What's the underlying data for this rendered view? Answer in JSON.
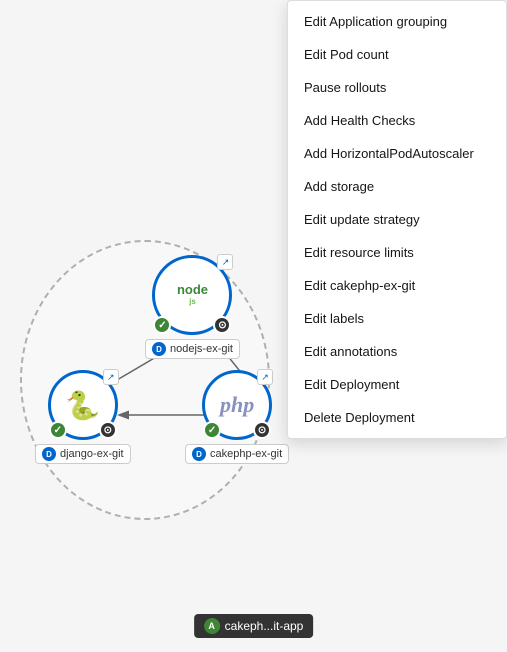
{
  "background": {
    "color": "#f5f5f5"
  },
  "menu": {
    "items": [
      {
        "id": "edit-app-grouping",
        "label": "Edit Application grouping"
      },
      {
        "id": "edit-pod-count",
        "label": "Edit Pod count"
      },
      {
        "id": "pause-rollouts",
        "label": "Pause rollouts"
      },
      {
        "id": "add-health-checks",
        "label": "Add Health Checks"
      },
      {
        "id": "add-hpa",
        "label": "Add HorizontalPodAutoscaler"
      },
      {
        "id": "add-storage",
        "label": "Add storage"
      },
      {
        "id": "edit-update-strategy",
        "label": "Edit update strategy"
      },
      {
        "id": "edit-resource-limits",
        "label": "Edit resource limits"
      },
      {
        "id": "edit-cakephp",
        "label": "Edit cakephp-ex-git"
      },
      {
        "id": "edit-labels",
        "label": "Edit labels"
      },
      {
        "id": "edit-annotations",
        "label": "Edit annotations"
      },
      {
        "id": "edit-deployment",
        "label": "Edit Deployment"
      },
      {
        "id": "delete-deployment",
        "label": "Delete Deployment"
      }
    ]
  },
  "nodes": {
    "nodejs": {
      "label": "nodejs-ex-git",
      "dot_letter": "D",
      "dot_color": "#0066cc"
    },
    "python": {
      "label": "django-ex-git",
      "dot_letter": "D",
      "dot_color": "#0066cc"
    },
    "php": {
      "label": "cakephp-ex-git",
      "dot_letter": "D",
      "dot_color": "#0066cc"
    }
  },
  "app_badge": {
    "letter": "A",
    "label": "cakeph...it-app",
    "dot_color": "#3e8635"
  }
}
